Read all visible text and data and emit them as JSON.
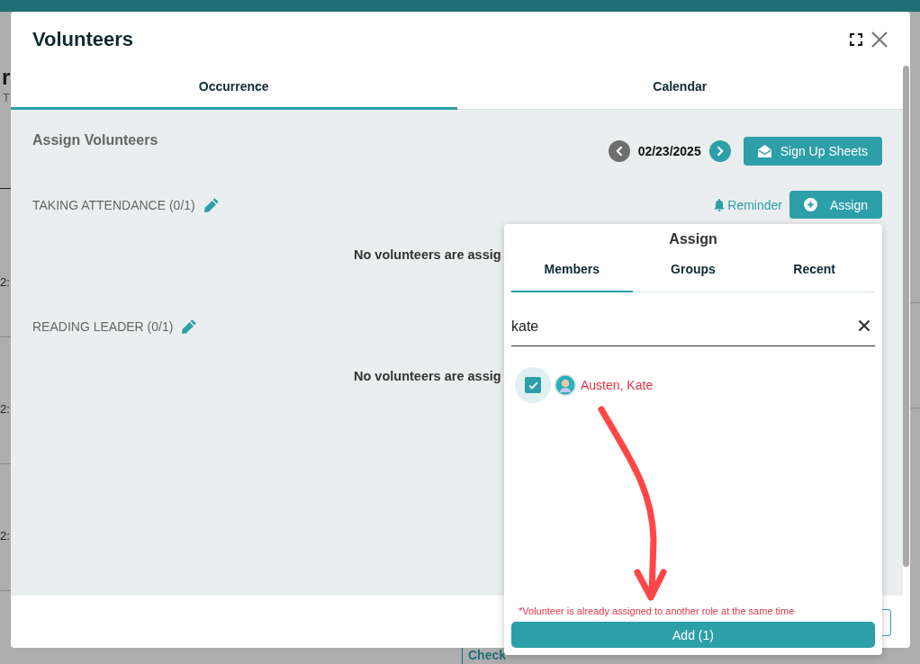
{
  "backdrop": {
    "heading_fragment": "r",
    "subheading_fragment": "T",
    "time_fragments": [
      "2:",
      "2:",
      "2:"
    ],
    "check_in": "Check"
  },
  "dialog": {
    "title": "Volunteers",
    "tabs": [
      {
        "label": "Occurrence",
        "selected": true
      },
      {
        "label": "Calendar",
        "selected": false
      }
    ],
    "section_title": "Assign Volunteers",
    "date": "02/23/2025",
    "sign_up_button": "Sign Up Sheets",
    "roles": [
      {
        "label": "TAKING ATTENDANCE (0/1)",
        "empty_message": "No volunteers are assig",
        "reminder": "Reminder",
        "assign_button": "Assign"
      },
      {
        "label": "READING LEADER (0/1)",
        "empty_message": "No volunteers are assig"
      }
    ]
  },
  "assign_panel": {
    "title": "Assign",
    "tabs": [
      {
        "label": "Members",
        "selected": true
      },
      {
        "label": "Groups",
        "selected": false
      },
      {
        "label": "Recent",
        "selected": false
      }
    ],
    "search": {
      "value": "kate"
    },
    "results": [
      {
        "name": "Austen, Kate",
        "checked": true,
        "conflict": true
      }
    ],
    "warning": "*Volunteer is already assigned to another role at the same time",
    "add_button": "Add (1)"
  },
  "annotations": [
    {
      "kind": "arrow"
    }
  ]
}
